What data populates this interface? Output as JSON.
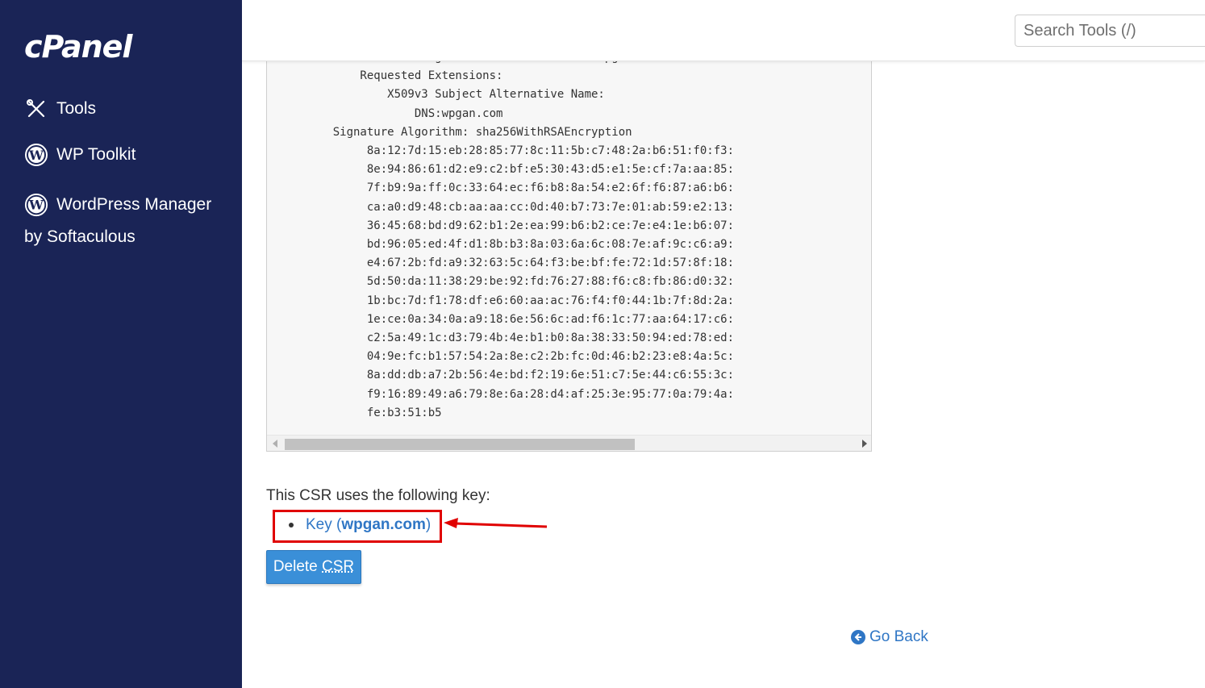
{
  "sidebar": {
    "logo": "cPanel",
    "items": [
      {
        "label": "Tools",
        "icon": "tools-icon"
      },
      {
        "label": "WP Toolkit",
        "icon": "wordpress-icon"
      },
      {
        "label": "WordPress Manager by Softaculous",
        "icon": "wordpress-icon"
      }
    ]
  },
  "header": {
    "search_placeholder": "Search Tools (/)"
  },
  "csr": {
    "lines": [
      "            challengePassword        :kuncIwpgan",
      "        Requested Extensions:",
      "            X509v3 Subject Alternative Name:",
      "                DNS:wpgan.com",
      "    Signature Algorithm: sha256WithRSAEncryption",
      "         8a:12:7d:15:eb:28:85:77:8c:11:5b:c7:48:2a:b6:51:f0:f3:",
      "         8e:94:86:61:d2:e9:c2:bf:e5:30:43:d5:e1:5e:cf:7a:aa:85:",
      "         7f:b9:9a:ff:0c:33:64:ec:f6:b8:8a:54:e2:6f:f6:87:a6:b6:",
      "         ca:a0:d9:48:cb:aa:aa:cc:0d:40:b7:73:7e:01:ab:59:e2:13:",
      "         36:45:68:bd:d9:62:b1:2e:ea:99:b6:b2:ce:7e:e4:1e:b6:07:",
      "         bd:96:05:ed:4f:d1:8b:b3:8a:03:6a:6c:08:7e:af:9c:c6:a9:",
      "         e4:67:2b:fd:a9:32:63:5c:64:f3:be:bf:fe:72:1d:57:8f:18:",
      "         5d:50:da:11:38:29:be:92:fd:76:27:88:f6:c8:fb:86:d0:32:",
      "         1b:bc:7d:f1:78:df:e6:60:aa:ac:76:f4:f0:44:1b:7f:8d:2a:",
      "         1e:ce:0a:34:0a:a9:18:6e:56:6c:ad:f6:1c:77:aa:64:17:c6:",
      "         c2:5a:49:1c:d3:79:4b:4e:b1:b0:8a:38:33:50:94:ed:78:ed:",
      "         04:9e:fc:b1:57:54:2a:8e:c2:2b:fc:0d:46:b2:23:e8:4a:5c:",
      "         8a:dd:db:a7:2b:56:4e:bd:f2:19:6e:51:c7:5e:44:c6:55:3c:",
      "         f9:16:89:49:a6:79:8e:6a:28:d4:af:25:3e:95:77:0a:79:4a:",
      "         fe:b3:51:b5"
    ]
  },
  "main": {
    "uses_key_text": "This CSR uses the following key:",
    "key_prefix": "Key (",
    "key_domain": "wpgan.com",
    "key_suffix": ")",
    "delete_label": "Delete ",
    "delete_abbr": "CSR",
    "go_back": "Go Back"
  },
  "colors": {
    "sidebar_bg": "#1a2456",
    "link": "#2f76c5",
    "button": "#3a8fd8",
    "highlight": "#e00000"
  }
}
